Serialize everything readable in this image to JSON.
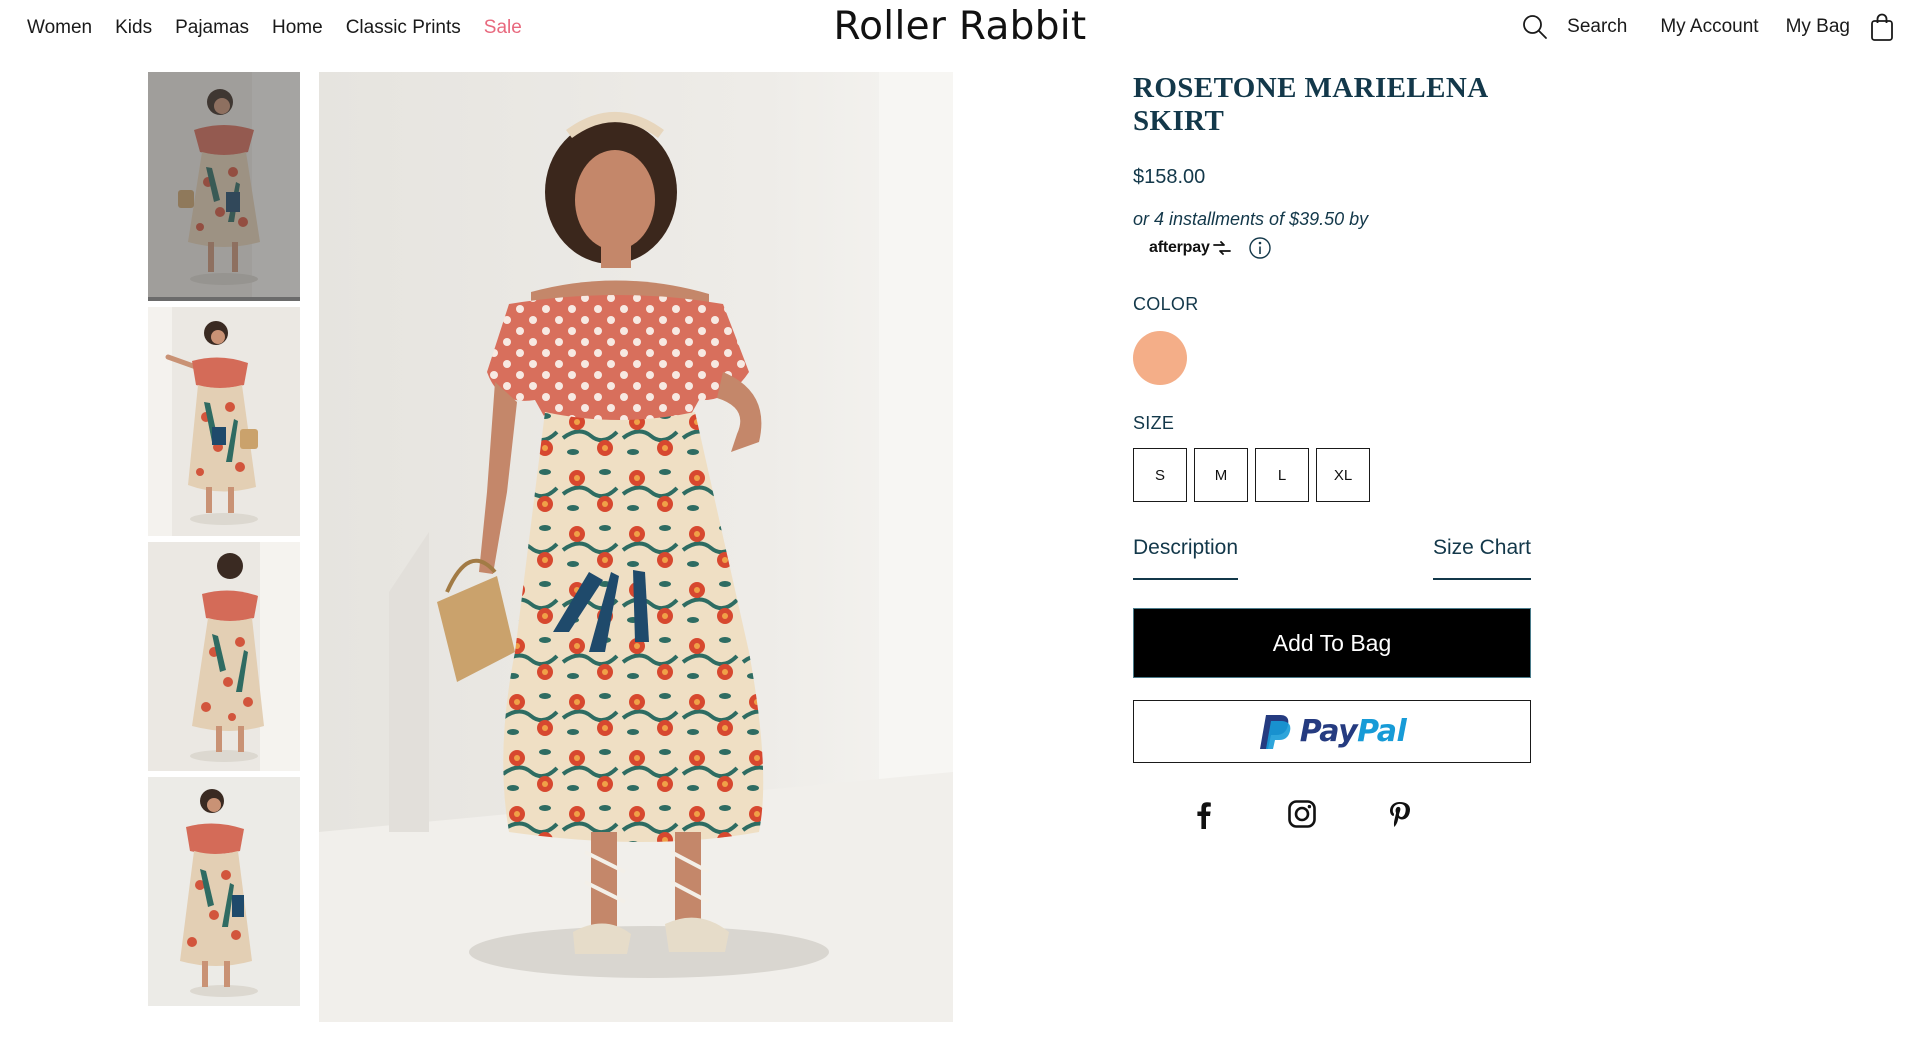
{
  "header": {
    "nav": [
      {
        "label": "Women"
      },
      {
        "label": "Kids"
      },
      {
        "label": "Pajamas"
      },
      {
        "label": "Home"
      },
      {
        "label": "Classic Prints"
      },
      {
        "label": "Sale",
        "color": "#e8697e"
      }
    ],
    "brand": "Roller Rabbit",
    "search_label": "Search",
    "account_label": "My Account",
    "bag_label": "My Bag"
  },
  "gallery": {
    "thumbnails": [
      {
        "icon": "product-photo-front",
        "selected": true
      },
      {
        "icon": "product-photo-side-wave"
      },
      {
        "icon": "product-photo-back"
      },
      {
        "icon": "product-photo-pose"
      }
    ],
    "main_image_icon": "product-photo-front"
  },
  "product": {
    "title": "ROSETONE MARIELENA SKIRT",
    "price": "$158.00",
    "installments": "or 4 installments of $39.50 by",
    "afterpay_logo": "afterpay",
    "color_label": "COLOR",
    "swatch_color": "#f4ae88",
    "size_label": "SIZE",
    "sizes": [
      "S",
      "M",
      "L",
      "XL"
    ],
    "tabs": [
      "Description",
      "Size Chart"
    ],
    "add_to_bag": "Add To Bag",
    "paypal": {
      "part1": "Pay",
      "part2": "Pal"
    },
    "socials": [
      "facebook-icon",
      "instagram-icon",
      "pinterest-icon"
    ]
  },
  "colors": {
    "title_text": "#13384a",
    "sale": "#e8697e",
    "button_bg": "#000000",
    "paypal_dark": "#253b80",
    "paypal_light": "#179bd7"
  }
}
